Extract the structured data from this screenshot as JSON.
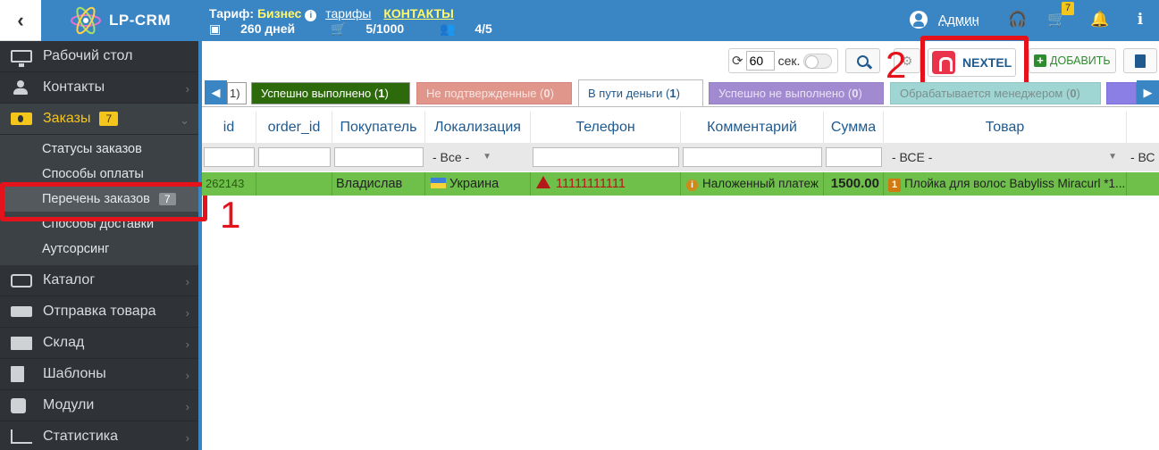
{
  "header": {
    "back_glyph": "‹",
    "brand_name": "LP-CRM",
    "tariff_label": "Тариф:",
    "tariff_value": "Бизнес",
    "tariffs_link": "тарифы",
    "contacts_link": "КОНТАКТЫ",
    "days": "260 дней",
    "orders_count": "5/1000",
    "users_count": "4/5",
    "user_name": "Админ",
    "cart_badge": "7"
  },
  "sidebar": {
    "items": [
      {
        "label": "Рабочий стол",
        "icon": "monitor-icon"
      },
      {
        "label": "Контакты",
        "icon": "users-icon"
      },
      {
        "label": "Заказы",
        "icon": "money-icon",
        "badge": "7"
      },
      {
        "label": "Каталог",
        "icon": "inbox-icon"
      },
      {
        "label": "Отправка товара",
        "icon": "truck-icon"
      },
      {
        "label": "Склад",
        "icon": "archive-icon"
      },
      {
        "label": "Шаблоны",
        "icon": "file-icon"
      },
      {
        "label": "Модули",
        "icon": "puzzle-icon"
      },
      {
        "label": "Статистика",
        "icon": "chart-icon"
      }
    ],
    "sub_items": [
      {
        "label": "Статусы заказов"
      },
      {
        "label": "Способы оплаты"
      },
      {
        "label": "Перечень заказов",
        "badge": "7"
      },
      {
        "label": "Способы доставки"
      },
      {
        "label": "Аутсорсинг"
      }
    ]
  },
  "toolbar": {
    "refresh_seconds": "60",
    "sec_label": "сек.",
    "nextel_label": "NEXTEL",
    "add_label": "ДОБАВИТЬ"
  },
  "annotations": {
    "one": "1",
    "two": "2"
  },
  "status_tabs": [
    {
      "label": "Успешно выполнено",
      "count": "1",
      "bg": "#2d6a0b",
      "fg": "#ffffff"
    },
    {
      "label": "Не подтвержденные",
      "count": "0",
      "bg": "#e0968b",
      "fg": "#f7e3df"
    },
    {
      "label": "В пути деньги",
      "count": "1",
      "bg": "#ffffff",
      "fg": "#1f5a8f"
    },
    {
      "label": "Успешно не выполнено",
      "count": "0",
      "bg": "#a28ad0",
      "fg": "#e9e2f5"
    },
    {
      "label": "Обрабатывается менеджером",
      "count": "0",
      "bg": "#9fd6d3",
      "fg": "#7c8f8e"
    }
  ],
  "status_tab_partial": "1)",
  "table": {
    "columns": [
      "id",
      "order_id",
      "Покупатель",
      "Локализация",
      "Телефон",
      "Комментарий",
      "Сумма",
      "Товар"
    ],
    "filters": {
      "localization": "- Все -",
      "product": "- ВСЕ -",
      "next": "- ВС"
    },
    "rows": [
      {
        "id": "262143",
        "order_id": "",
        "buyer": "Владислав",
        "country": "Украина",
        "phone": "11111111111",
        "comment": "Наложенный платеж",
        "sum": "1500.00",
        "qty": "1",
        "product": "Плойка для волос Babyliss Miracurl *1..."
      }
    ]
  },
  "colors": {
    "brand_blue": "#3a85c4",
    "sidebar_bg": "#2f3338",
    "accent_yellow": "#f4c51b",
    "row_green": "#6ec04a",
    "highlight_red": "#e3121b"
  }
}
